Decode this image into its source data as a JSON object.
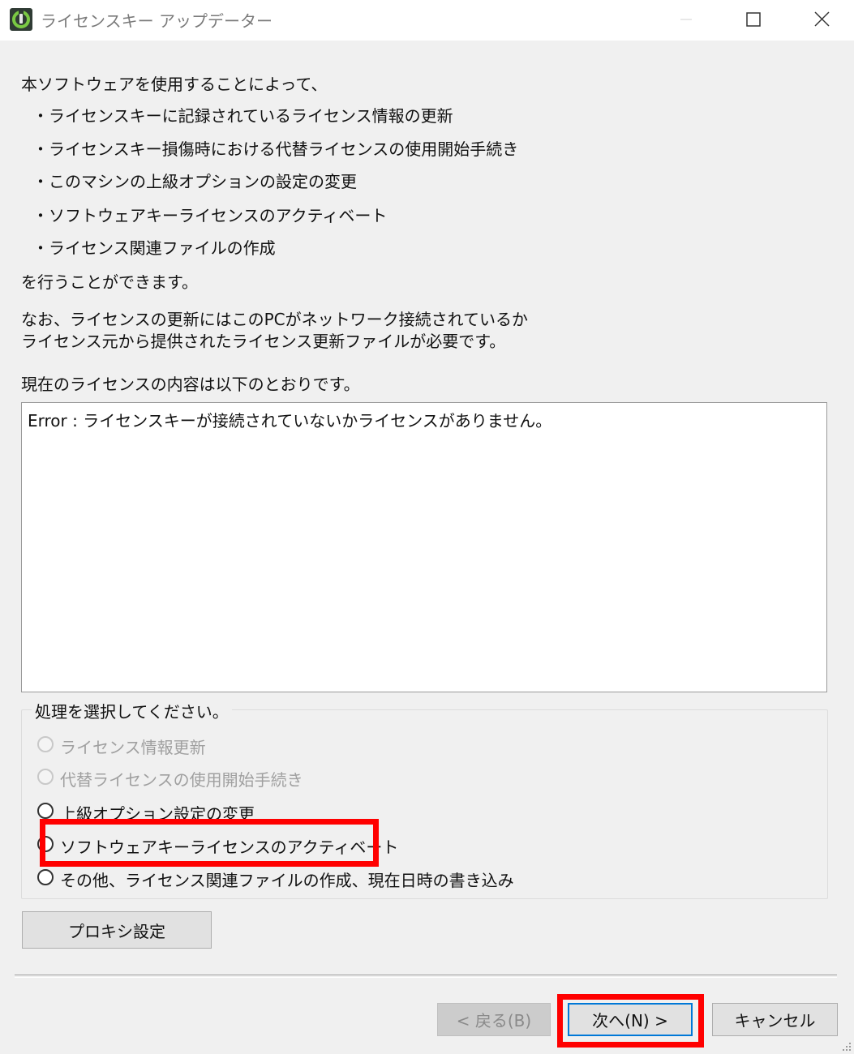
{
  "window": {
    "title": "ライセンスキー アップデーター"
  },
  "intro": {
    "lead": "本ソフトウェアを使用することによって、",
    "bullets": [
      "・ライセンスキーに記録されているライセンス情報の更新",
      "・ライセンスキー損傷時における代替ライセンスの使用開始手続き",
      "・このマシンの上級オプションの設定の変更",
      "・ソフトウェアキーライセンスのアクティベート",
      "・ライセンス関連ファイルの作成"
    ],
    "closing": "を行うことができます。",
    "note_line1": "なお、ライセンスの更新にはこのPCがネットワーク接続されているか",
    "note_line2": "ライセンス元から提供されたライセンス更新ファイルが必要です。",
    "current_label": "現在のライセンスの内容は以下のとおりです。"
  },
  "license_box": {
    "content": "Error : ライセンスキーが接続されていないかライセンスがありません。"
  },
  "process_group": {
    "legend": "処理を選択してください。",
    "options": [
      {
        "label": "ライセンス情報更新",
        "enabled": false,
        "selected": false
      },
      {
        "label": "代替ライセンスの使用開始手続き",
        "enabled": false,
        "selected": false
      },
      {
        "label": "上級オプション設定の変更",
        "enabled": true,
        "selected": false
      },
      {
        "label": "ソフトウェアキーライセンスのアクティベート",
        "enabled": true,
        "selected": false,
        "highlighted": true
      },
      {
        "label": "その他、ライセンス関連ファイルの作成、現在日時の書き込み",
        "enabled": true,
        "selected": false
      }
    ]
  },
  "buttons": {
    "proxy": "プロキシ設定",
    "back": "< 戻る(B)",
    "next": "次へ(N) >",
    "cancel": "キャンセル"
  },
  "colors": {
    "highlight": "#ff0000",
    "dialog_bg": "#f0f0f0",
    "button_bg": "#e1e1e1"
  }
}
